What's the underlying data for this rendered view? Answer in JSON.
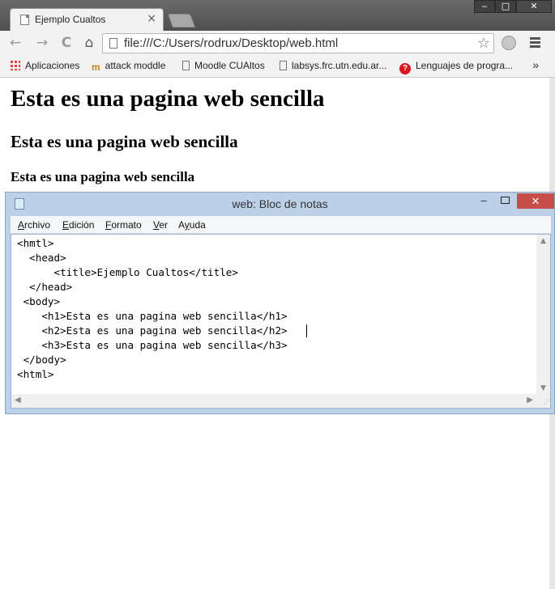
{
  "browser": {
    "tab": {
      "title": "Ejemplo Cualtos",
      "close": "×"
    },
    "window_buttons": {
      "minimize": "‒",
      "maximize": "□",
      "close": "✕"
    },
    "nav": {
      "back": "←",
      "forward": "→",
      "reload": "C",
      "home": "⌂"
    },
    "address": {
      "url": "file:///C:/Users/rodrux/Desktop/web.html",
      "star": "☆"
    },
    "bookmarks": [
      {
        "label": "Aplicaciones",
        "icon": "apps-grid-icon"
      },
      {
        "label": "attack moddle",
        "icon": "moodle-icon"
      },
      {
        "label": "Moodle CUAltos",
        "icon": "document-icon"
      },
      {
        "label": "labsys.frc.utn.edu.ar...",
        "icon": "document-icon"
      },
      {
        "label": "Lenguajes de progra...",
        "icon": "question-icon"
      }
    ],
    "bookmarks_more": "»"
  },
  "page": {
    "h1": "Esta es una pagina web sencilla",
    "h2": "Esta es una pagina web sencilla",
    "h3": "Esta es una pagina web sencilla"
  },
  "notepad": {
    "title": "web: Bloc de notas",
    "buttons": {
      "minimize": "‒",
      "close": "✕"
    },
    "menu": [
      {
        "label": "Archivo",
        "mnemonic": "A"
      },
      {
        "label": "Edición",
        "mnemonic": "E"
      },
      {
        "label": "Formato",
        "mnemonic": "F"
      },
      {
        "label": "Ver",
        "mnemonic": "V"
      },
      {
        "label": "Ayuda",
        "mnemonic": "y"
      }
    ],
    "content": "<hmtl>\n  <head>\n      <title>Ejemplo Cualtos</title>\n  </head>\n <body>\n    <h1>Esta es una pagina web sencilla</h1>\n    <h2>Esta es una pagina web sencilla</h2>\n    <h3>Esta es una pagina web sencilla</h3>\n </body>\n<html>"
  }
}
